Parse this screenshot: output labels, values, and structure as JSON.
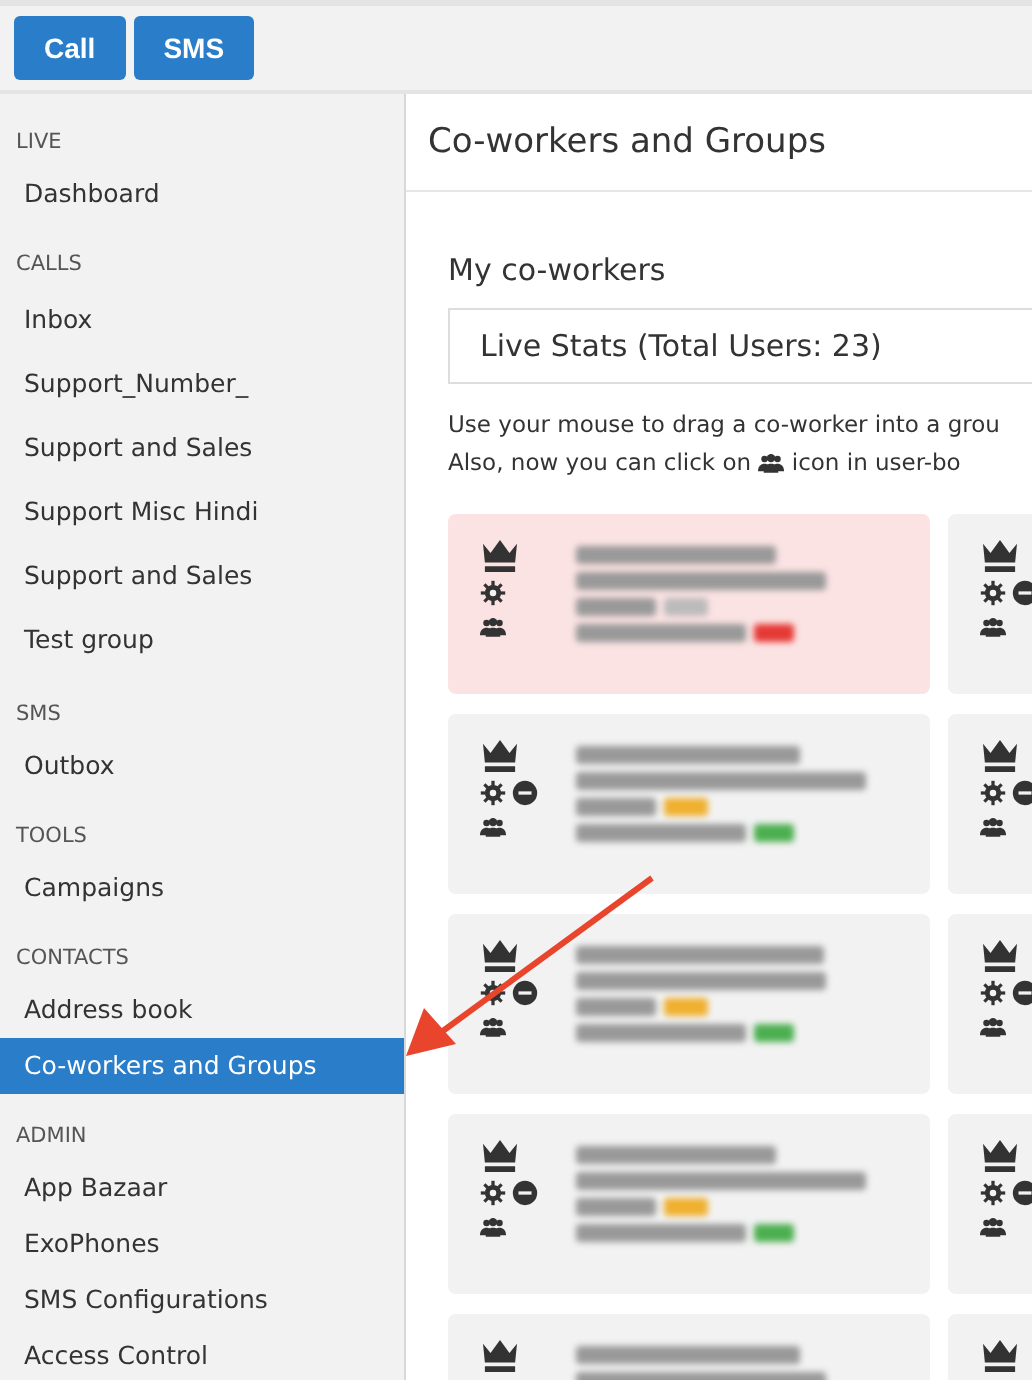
{
  "toolbar": {
    "buttons": [
      "Call",
      "SMS"
    ]
  },
  "sidebar": {
    "sections": [
      {
        "label": "LIVE",
        "items": [
          {
            "label": "Dashboard",
            "selected": false
          }
        ]
      },
      {
        "label": "CALLS",
        "items": [
          {
            "label": "Inbox",
            "selected": false
          },
          {
            "label": "Support_Number_",
            "selected": false
          },
          {
            "label": "Support and Sales",
            "selected": false
          },
          {
            "label": "Support Misc Hindi",
            "selected": false
          },
          {
            "label": "Support and Sales",
            "selected": false
          },
          {
            "label": "Test group",
            "selected": false
          }
        ]
      },
      {
        "label": "SMS",
        "items": [
          {
            "label": "Outbox",
            "selected": false
          }
        ]
      },
      {
        "label": "TOOLS",
        "items": [
          {
            "label": "Campaigns",
            "selected": false
          }
        ]
      },
      {
        "label": "CONTACTS",
        "items": [
          {
            "label": "Address book",
            "selected": false
          },
          {
            "label": "Co-workers and Groups",
            "selected": true
          }
        ]
      },
      {
        "label": "ADMIN",
        "items": [
          {
            "label": "App Bazaar",
            "selected": false
          },
          {
            "label": "ExoPhones",
            "selected": false
          },
          {
            "label": "SMS Configurations",
            "selected": false
          },
          {
            "label": "Access Control",
            "selected": false
          }
        ]
      }
    ]
  },
  "main": {
    "title": "Co-workers and Groups",
    "heading": "My co-workers",
    "stats": "Live Stats (Total Users: 23)",
    "hint_line": "Use your mouse to drag a co-worker into a grou",
    "hint_before_icon": "Also, now you can click on",
    "hint_after_icon": "icon in user-bo",
    "cards": [
      {
        "highlighted": true,
        "removable": false,
        "color": "#e53935"
      },
      {
        "highlighted": false,
        "removable": true,
        "color": "#4caf50"
      },
      {
        "highlighted": false,
        "removable": true,
        "color": "#4caf50"
      },
      {
        "highlighted": false,
        "removable": true,
        "color": "#4caf50"
      },
      {
        "highlighted": false
      }
    ],
    "cards_right": [
      {
        "highlighted": false,
        "removable": true
      },
      {
        "highlighted": false,
        "removable": true
      },
      {
        "highlighted": false,
        "removable": true
      },
      {
        "highlighted": false,
        "removable": true
      },
      {
        "highlighted": false
      }
    ]
  }
}
